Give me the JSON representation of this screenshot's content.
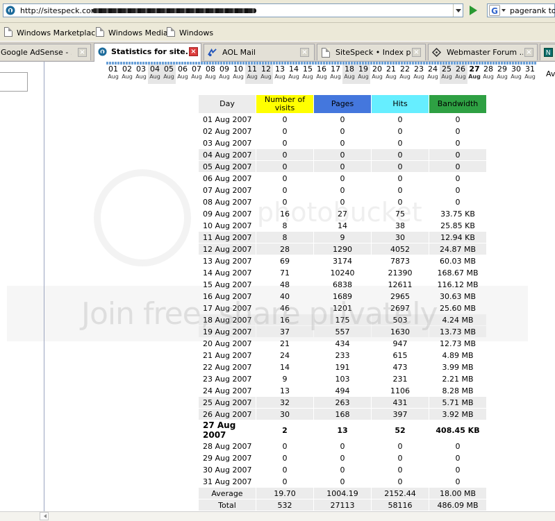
{
  "browser": {
    "url": "http://sitespeck.com",
    "search_text": "pagerank too",
    "bookmarks": [
      "Windows Marketplace",
      "Windows Media",
      "Windows"
    ],
    "tabs": [
      {
        "label": "Google AdSense - ...",
        "active": false
      },
      {
        "label": "Statistics for site...",
        "active": true
      },
      {
        "label": "AOL Mail",
        "active": false
      },
      {
        "label": "SiteSpeck • Index p...",
        "active": false
      },
      {
        "label": "Webmaster Forum ...",
        "active": false
      }
    ]
  },
  "day_strip": {
    "month_abbr": "Aug",
    "days": [
      "01",
      "02",
      "03",
      "04",
      "05",
      "06",
      "07",
      "08",
      "09",
      "10",
      "11",
      "12",
      "13",
      "14",
      "15",
      "16",
      "17",
      "18",
      "19",
      "20",
      "21",
      "22",
      "23",
      "24",
      "25",
      "26",
      "27",
      "28",
      "29",
      "30",
      "31"
    ],
    "weekend_days": [
      "04",
      "05",
      "11",
      "12",
      "18",
      "19",
      "25",
      "26"
    ],
    "current_day": "27",
    "trailing_label": "Av"
  },
  "table": {
    "headers": {
      "day": "Day",
      "visits": "Number of visits",
      "pages": "Pages",
      "hits": "Hits",
      "bandwidth": "Bandwidth"
    },
    "header_colors": {
      "visits": "#ffff00",
      "pages": "#4477dd",
      "hits": "#66eeff",
      "bandwidth": "#2ea043"
    },
    "rows": [
      {
        "day": "01 Aug 2007",
        "visits": "0",
        "pages": "0",
        "hits": "0",
        "bandwidth": "0",
        "weekend": false
      },
      {
        "day": "02 Aug 2007",
        "visits": "0",
        "pages": "0",
        "hits": "0",
        "bandwidth": "0",
        "weekend": false
      },
      {
        "day": "03 Aug 2007",
        "visits": "0",
        "pages": "0",
        "hits": "0",
        "bandwidth": "0",
        "weekend": false
      },
      {
        "day": "04 Aug 2007",
        "visits": "0",
        "pages": "0",
        "hits": "0",
        "bandwidth": "0",
        "weekend": true
      },
      {
        "day": "05 Aug 2007",
        "visits": "0",
        "pages": "0",
        "hits": "0",
        "bandwidth": "0",
        "weekend": true
      },
      {
        "day": "06 Aug 2007",
        "visits": "0",
        "pages": "0",
        "hits": "0",
        "bandwidth": "0",
        "weekend": false
      },
      {
        "day": "07 Aug 2007",
        "visits": "0",
        "pages": "0",
        "hits": "0",
        "bandwidth": "0",
        "weekend": false
      },
      {
        "day": "08 Aug 2007",
        "visits": "0",
        "pages": "0",
        "hits": "0",
        "bandwidth": "0",
        "weekend": false
      },
      {
        "day": "09 Aug 2007",
        "visits": "16",
        "pages": "27",
        "hits": "75",
        "bandwidth": "33.75 KB",
        "weekend": false
      },
      {
        "day": "10 Aug 2007",
        "visits": "8",
        "pages": "14",
        "hits": "38",
        "bandwidth": "25.85 KB",
        "weekend": false
      },
      {
        "day": "11 Aug 2007",
        "visits": "8",
        "pages": "9",
        "hits": "30",
        "bandwidth": "12.94 KB",
        "weekend": true
      },
      {
        "day": "12 Aug 2007",
        "visits": "28",
        "pages": "1290",
        "hits": "4052",
        "bandwidth": "24.87 MB",
        "weekend": true
      },
      {
        "day": "13 Aug 2007",
        "visits": "69",
        "pages": "3174",
        "hits": "7873",
        "bandwidth": "60.03 MB",
        "weekend": false
      },
      {
        "day": "14 Aug 2007",
        "visits": "71",
        "pages": "10240",
        "hits": "21390",
        "bandwidth": "168.67 MB",
        "weekend": false
      },
      {
        "day": "15 Aug 2007",
        "visits": "48",
        "pages": "6838",
        "hits": "12611",
        "bandwidth": "116.12 MB",
        "weekend": false
      },
      {
        "day": "16 Aug 2007",
        "visits": "40",
        "pages": "1689",
        "hits": "2965",
        "bandwidth": "30.63 MB",
        "weekend": false
      },
      {
        "day": "17 Aug 2007",
        "visits": "46",
        "pages": "1201",
        "hits": "2697",
        "bandwidth": "25.60 MB",
        "weekend": false
      },
      {
        "day": "18 Aug 2007",
        "visits": "16",
        "pages": "175",
        "hits": "503",
        "bandwidth": "4.24 MB",
        "weekend": true
      },
      {
        "day": "19 Aug 2007",
        "visits": "37",
        "pages": "557",
        "hits": "1630",
        "bandwidth": "13.73 MB",
        "weekend": true
      },
      {
        "day": "20 Aug 2007",
        "visits": "21",
        "pages": "434",
        "hits": "947",
        "bandwidth": "12.73 MB",
        "weekend": false
      },
      {
        "day": "21 Aug 2007",
        "visits": "24",
        "pages": "233",
        "hits": "615",
        "bandwidth": "4.89 MB",
        "weekend": false
      },
      {
        "day": "22 Aug 2007",
        "visits": "14",
        "pages": "191",
        "hits": "473",
        "bandwidth": "3.99 MB",
        "weekend": false
      },
      {
        "day": "23 Aug 2007",
        "visits": "9",
        "pages": "103",
        "hits": "231",
        "bandwidth": "2.21 MB",
        "weekend": false
      },
      {
        "day": "24 Aug 2007",
        "visits": "13",
        "pages": "494",
        "hits": "1106",
        "bandwidth": "8.28 MB",
        "weekend": false
      },
      {
        "day": "25 Aug 2007",
        "visits": "32",
        "pages": "263",
        "hits": "431",
        "bandwidth": "5.71 MB",
        "weekend": true
      },
      {
        "day": "26 Aug 2007",
        "visits": "30",
        "pages": "168",
        "hits": "397",
        "bandwidth": "3.92 MB",
        "weekend": true
      },
      {
        "day": "27 Aug 2007",
        "visits": "2",
        "pages": "13",
        "hits": "52",
        "bandwidth": "408.45 KB",
        "weekend": false,
        "current": true
      },
      {
        "day": "28 Aug 2007",
        "visits": "0",
        "pages": "0",
        "hits": "0",
        "bandwidth": "0",
        "weekend": false
      },
      {
        "day": "29 Aug 2007",
        "visits": "0",
        "pages": "0",
        "hits": "0",
        "bandwidth": "0",
        "weekend": false
      },
      {
        "day": "30 Aug 2007",
        "visits": "0",
        "pages": "0",
        "hits": "0",
        "bandwidth": "0",
        "weekend": false
      },
      {
        "day": "31 Aug 2007",
        "visits": "0",
        "pages": "0",
        "hits": "0",
        "bandwidth": "0",
        "weekend": false
      }
    ],
    "average": {
      "label": "Average",
      "visits": "19.70",
      "pages": "1004.19",
      "hits": "2152.44",
      "bandwidth": "18.00 MB"
    },
    "total": {
      "label": "Total",
      "visits": "532",
      "pages": "27113",
      "hits": "58116",
      "bandwidth": "486.09 MB"
    }
  },
  "watermark": {
    "brand": "photobucket",
    "tagline": "Join free, share privately"
  }
}
